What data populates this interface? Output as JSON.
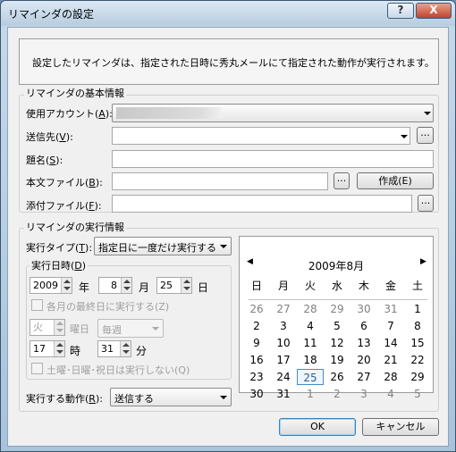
{
  "window": {
    "title": "リマインダの設定",
    "help": "?",
    "close": "X"
  },
  "message": "設定したリマインダは、指定された日時に秀丸メールにて指定された動作が実行されます。",
  "basic": {
    "group_label": "リマインダの基本情報",
    "account_label": "使用アカウント(",
    "account_key": "A",
    "dest_label": "送信先(",
    "dest_key": "V",
    "subject_label": "題名(",
    "subject_key": "S",
    "body_label": "本文ファイル(",
    "body_key": "B",
    "attach_label": "添付ファイル(",
    "attach_key": "F",
    "close_paren": "):",
    "browse": "...",
    "create_btn": "作成(E)"
  },
  "exec": {
    "group_label": "リマインダの実行情報",
    "type_label": "実行タイプ(",
    "type_key": "T",
    "type_value": "指定日に一度だけ実行する",
    "datetime_label": "実行日時(",
    "datetime_key": "D",
    "year": "2009",
    "year_unit": "年",
    "month": "8",
    "month_unit": "月",
    "day": "25",
    "day_unit": "日",
    "last_day_label": "各月の最終日に実行する(Z)",
    "weekday": "火",
    "weekday_unit": "曜日",
    "every": "毎週",
    "hour": "17",
    "hour_unit": "時",
    "minute": "31",
    "minute_unit": "分",
    "holiday_label": "土曜･日曜･祝日は実行しない(Q)",
    "action_label": "実行する動作(",
    "action_key": "R",
    "action_value": "送信する"
  },
  "calendar": {
    "month_title": "2009年8月",
    "prev": "◀",
    "next": "▶",
    "weekdays": [
      "日",
      "月",
      "火",
      "水",
      "木",
      "金",
      "土"
    ],
    "rows": [
      [
        "26",
        "27",
        "28",
        "29",
        "30",
        "31",
        "1"
      ],
      [
        "2",
        "3",
        "4",
        "5",
        "6",
        "7",
        "8"
      ],
      [
        "9",
        "10",
        "11",
        "12",
        "13",
        "14",
        "15"
      ],
      [
        "16",
        "17",
        "18",
        "19",
        "20",
        "21",
        "22"
      ],
      [
        "23",
        "24",
        "25",
        "26",
        "27",
        "28",
        "29"
      ],
      [
        "30",
        "31",
        "1",
        "2",
        "3",
        "4",
        "5"
      ]
    ],
    "selected": "25"
  },
  "buttons": {
    "ok": "OK",
    "cancel": "キャンセル"
  }
}
